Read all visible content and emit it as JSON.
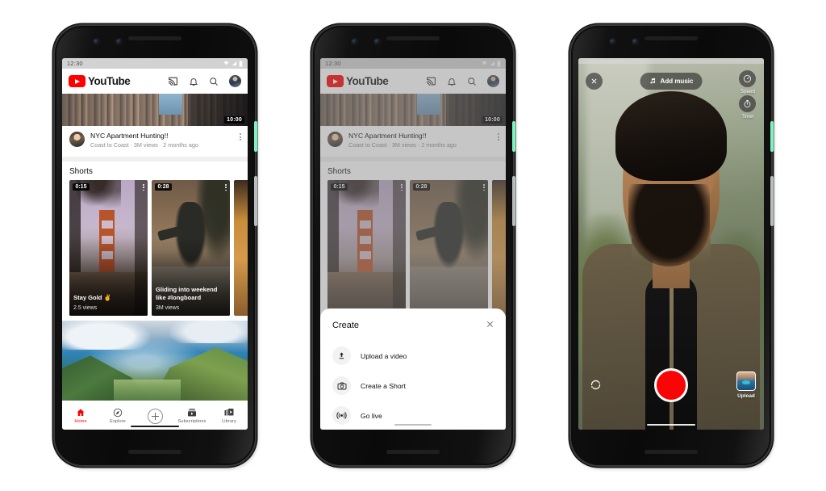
{
  "phones": {
    "home": {
      "status_bar": {
        "time": "12:30",
        "icons": [
          "wifi-icon",
          "signal-icon",
          "battery-icon"
        ]
      },
      "header": {
        "logo_text": "YouTube",
        "actions": [
          "cast-icon",
          "bell-icon",
          "search-icon",
          "avatar"
        ]
      },
      "video_card": {
        "duration": "10:00",
        "title": "NYC Apartment Hunting!!",
        "subtitle": "Coast to Coast · 3M views · 2 months ago",
        "menu_icon": "kebab-menu-icon"
      },
      "shorts": {
        "section_title": "Shorts",
        "items": [
          {
            "duration": "0:15",
            "title": "Stay Gold ✌️",
            "views": "2.5 views"
          },
          {
            "duration": "0:28",
            "title": "Gliding into weekend like #longboard",
            "views": "3M views"
          },
          {
            "duration": "",
            "title": "",
            "views": ""
          }
        ]
      },
      "bottom_nav": {
        "items": [
          {
            "label": "Home",
            "icon": "home-icon",
            "active": true
          },
          {
            "label": "Explore",
            "icon": "compass-icon",
            "active": false
          },
          {
            "label": "",
            "icon": "plus-create-icon",
            "active": false
          },
          {
            "label": "Subscriptions",
            "icon": "subscriptions-icon",
            "active": false
          },
          {
            "label": "Library",
            "icon": "library-icon",
            "active": false
          }
        ],
        "active_color": "#ff0000"
      }
    },
    "create_sheet": {
      "status_bar": {
        "time": "12:30"
      },
      "header": {
        "logo_text": "YouTube"
      },
      "video_card": {
        "duration": "10:00",
        "title": "NYC Apartment Hunting!!",
        "subtitle": "Coast to Coast · 3M views · 2 months ago"
      },
      "shorts": {
        "section_title": "Shorts",
        "items": [
          {
            "duration": "0:15"
          },
          {
            "duration": "0:28"
          }
        ]
      },
      "sheet": {
        "title": "Create",
        "close_icon": "close-icon",
        "options": [
          {
            "label": "Upload a video",
            "icon": "upload-icon"
          },
          {
            "label": "Create a Short",
            "icon": "camera-icon"
          },
          {
            "label": "Go live",
            "icon": "broadcast-icon"
          }
        ]
      }
    },
    "camera": {
      "close_icon": "close-icon",
      "add_music": {
        "label": "Add music",
        "icon": "music-note-icon"
      },
      "controls": [
        {
          "label": "Speed",
          "icon": "speedometer-icon"
        },
        {
          "label": "Timer",
          "icon": "timer-icon"
        }
      ],
      "record_button": {
        "name": "record-button",
        "color": "#fa0505"
      },
      "flip_icon": "flip-camera-icon",
      "upload": {
        "label": "Upload",
        "icon": "gallery-thumbnail"
      }
    }
  },
  "colors": {
    "youtube_red": "#ff0000",
    "record_red": "#fa0505",
    "power_button": "#7ff0c0",
    "text_primary": "#0f0f0f",
    "text_secondary": "#8d8d8d"
  }
}
